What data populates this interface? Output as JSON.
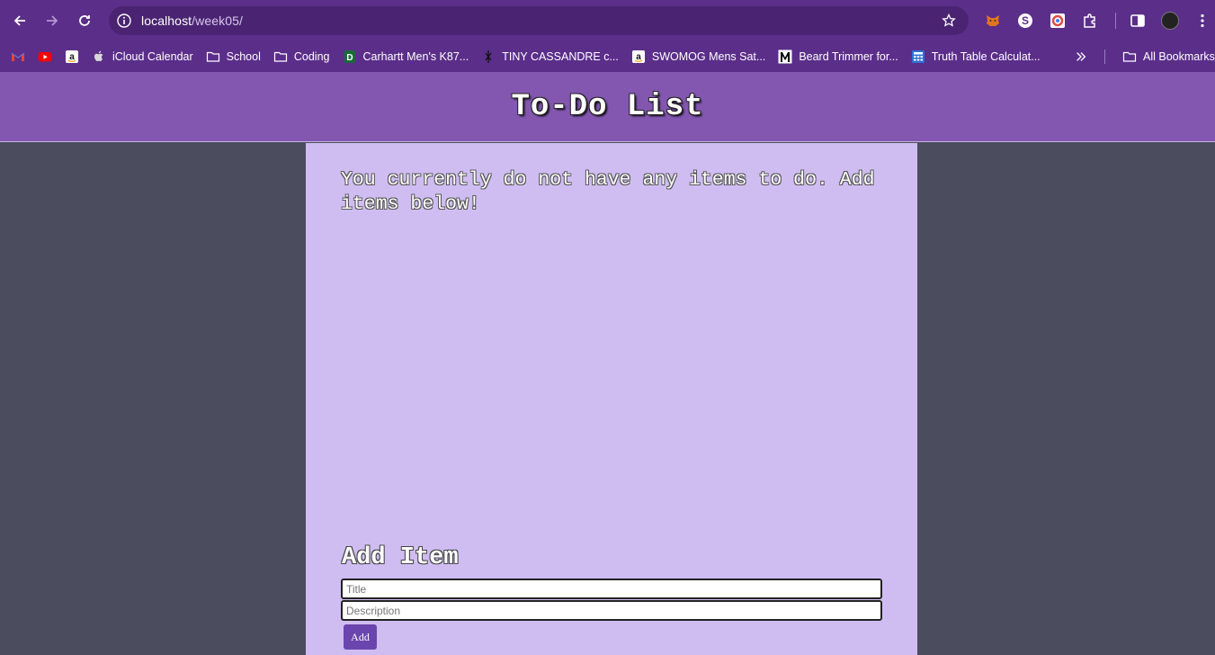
{
  "browser": {
    "url_host": "localhost",
    "url_path": "/week05/",
    "bookmarks": [
      {
        "label": "",
        "icon": "gmail-icon"
      },
      {
        "label": "",
        "icon": "youtube-icon"
      },
      {
        "label": "",
        "icon": "amazon-icon"
      },
      {
        "label": "iCloud Calendar",
        "icon": "apple-icon"
      },
      {
        "label": "School",
        "icon": "folder-icon"
      },
      {
        "label": "Coding",
        "icon": "folder-icon"
      },
      {
        "label": "Carhartt Men's K87...",
        "icon": "carhartt-icon"
      },
      {
        "label": "TINY CASSANDRE c...",
        "icon": "ysl-icon"
      },
      {
        "label": "SWOMOG Mens Sat...",
        "icon": "amazon-icon"
      },
      {
        "label": "Beard Trimmer for...",
        "icon": "m-icon"
      },
      {
        "label": "Truth Table Calculat...",
        "icon": "calculator-icon"
      }
    ],
    "all_bookmarks": "All Bookmarks"
  },
  "page": {
    "title": "To-Do List",
    "empty_message": "You currently do not have any items to do. Add items below!",
    "form": {
      "heading": "Add Item",
      "title_placeholder": "Title",
      "description_placeholder": "Description",
      "submit_label": "Add"
    }
  },
  "colors": {
    "chrome": "#5b2e8a",
    "header": "#8357b0",
    "content": "#cfbdf2",
    "background": "#4b4d5f",
    "button": "#6a45ad"
  }
}
